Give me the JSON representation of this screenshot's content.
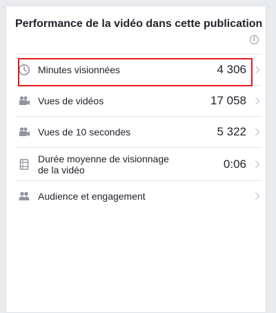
{
  "card": {
    "title": "Performance de la vidéo dans cette publication",
    "info_icon": "info-icon"
  },
  "metrics": [
    {
      "label": "Minutes visionnées",
      "value": "4 306",
      "icon": "clock-icon"
    },
    {
      "label": "Vues de vidéos",
      "value": "17 058",
      "icon": "video-camera-icon"
    },
    {
      "label": "Vues de 10 secondes",
      "value": "5 322",
      "icon": "video-camera-icon"
    },
    {
      "label": "Durée moyenne de visionnage de la vidéo",
      "value": "0:06",
      "icon": "film-icon"
    },
    {
      "label": "Audience et engagement",
      "value": "",
      "icon": "people-icon"
    }
  ],
  "colors": {
    "highlight": "#e3161b",
    "icon": "#90949c",
    "text": "#1d2129"
  }
}
